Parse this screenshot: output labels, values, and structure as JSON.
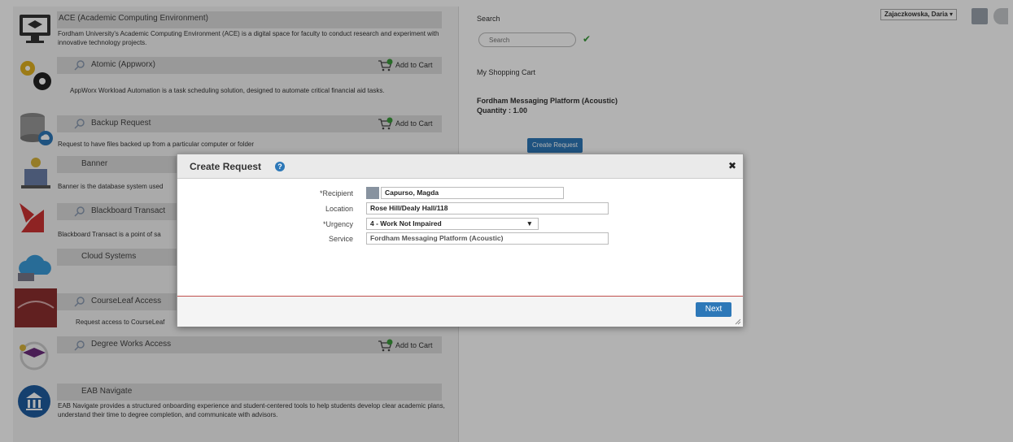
{
  "catalog": {
    "items": [
      {
        "title": "ACE (Academic Computing Environment)",
        "desc": "Fordham University's Academic Computing Environment (ACE) is a digital space for faculty to conduct research and experiment with innovative technology projects.",
        "icon": "monitor-icon"
      },
      {
        "title": "Atomic (Appworx)",
        "desc": "AppWorx Workload Automation is a task scheduling solution, designed to automate critical financial aid tasks.",
        "icon": "gears-icon",
        "cart": "Add to Cart"
      },
      {
        "title": "Backup Request",
        "desc": "Request to have files backed up from a particular computer or folder",
        "icon": "database-icon",
        "cart": "Add to Cart"
      },
      {
        "title": "Banner",
        "desc": "Banner is the database system used",
        "icon": "building-icon"
      },
      {
        "title": "Blackboard Transact",
        "desc": "Blackboard Transact is a point of sa",
        "icon": "blackboard-icon"
      },
      {
        "title": "Cloud Systems",
        "desc": "",
        "icon": "cloud-icon"
      },
      {
        "title": "CourseLeaf Access",
        "desc": "Request access to CourseLeaf",
        "icon": "courseleaf-icon"
      },
      {
        "title": "Degree Works Access",
        "desc": "",
        "icon": "graduation-icon",
        "cart": "Add to Cart"
      },
      {
        "title": "EAB Navigate",
        "desc": "EAB Navigate provides a structured onboarding experience and student-centered tools to help students develop clear academic plans, understand their time to degree completion, and communicate with advisors.",
        "icon": "bank-icon"
      }
    ]
  },
  "right": {
    "search_label": "Search",
    "search_placeholder": "Search",
    "cart_title": "My Shopping Cart",
    "cart_item": "Fordham Messaging Platform (Acoustic)",
    "cart_qty": "Quantity : 1.00",
    "create_button": "Create Request",
    "user_name": "Zajaczkowska, Daria"
  },
  "modal": {
    "title": "Create Request",
    "recipient_label": "*Recipient",
    "recipient_value": "Capurso, Magda",
    "location_label": "Location",
    "location_value": "Rose Hill/Dealy Hall/118",
    "urgency_label": "*Urgency",
    "urgency_value": "4 - Work Not Impaired",
    "service_label": "Service",
    "service_value": "Fordham Messaging Platform (Acoustic)",
    "next_button": "Next"
  }
}
